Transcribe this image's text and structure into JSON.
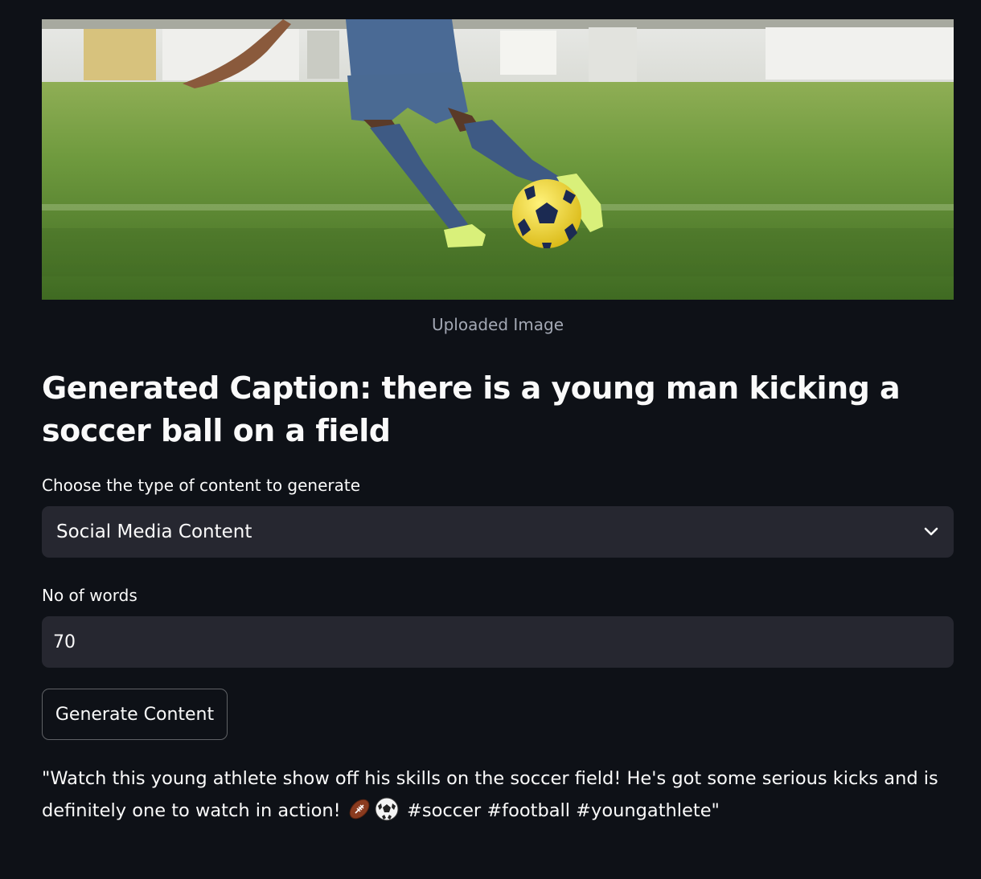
{
  "image": {
    "caption": "Uploaded Image"
  },
  "generated_caption": {
    "heading": "Generated Caption: there is a young man kicking a soccer ball on a field"
  },
  "content_type_select": {
    "label": "Choose the type of content to generate",
    "selected": "Social Media Content",
    "icon": "chevron-down-icon"
  },
  "word_count_input": {
    "label": "No of words",
    "value": "70"
  },
  "generate_button": {
    "label": "Generate Content"
  },
  "output": {
    "text_before_emoji": "\"Watch this young athlete show off his skills on the soccer field! He's got some serious kicks and is definitely one to watch in action! ",
    "emoji_1": "american-football-icon",
    "emoji_2": "soccer-ball-icon",
    "text_after_emoji": " #soccer #football #youngathlete\""
  },
  "colors": {
    "background": "#0e1117",
    "widget_background": "#262730",
    "text": "#fafafa",
    "caption_text": "#a3a8b4"
  }
}
